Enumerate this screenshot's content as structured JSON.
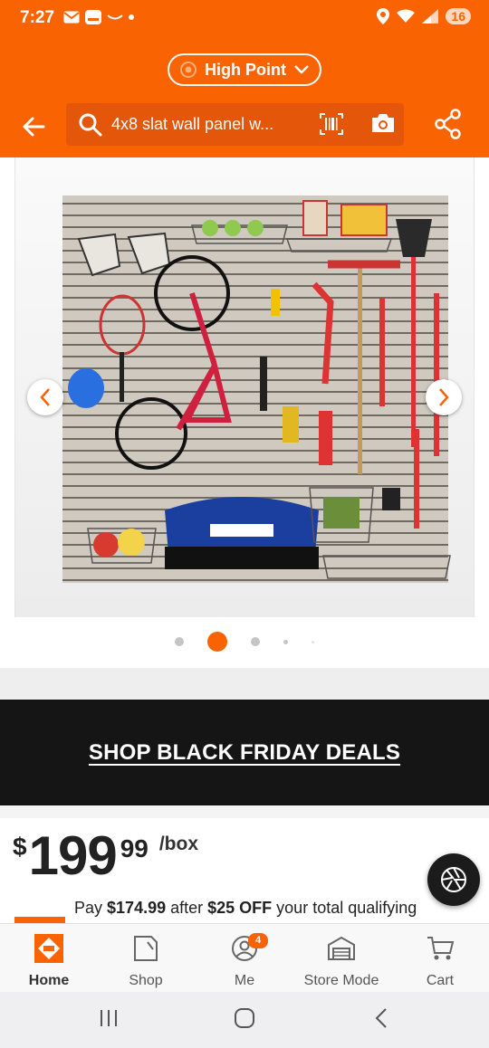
{
  "status_bar": {
    "time": "7:27",
    "battery": "16",
    "left_icons": [
      "gmail-icon",
      "notification-box-icon",
      "amazon-icon",
      "dot-icon"
    ],
    "right_icons": [
      "location-icon",
      "wifi-icon",
      "signal-icon"
    ]
  },
  "header": {
    "store_name": "High Point",
    "search_text": "4x8 slat wall panel w...",
    "icons": [
      "back-arrow-icon",
      "search-icon",
      "barcode-scan-icon",
      "camera-icon",
      "share-icon",
      "store-pin-icon",
      "chevron-down-icon"
    ]
  },
  "gallery": {
    "image_description_icon": "product-image",
    "dots_count": 5,
    "active_index": 1
  },
  "promo_banner": {
    "label": "SHOP BLACK FRIDAY DEALS"
  },
  "price": {
    "currency": "$",
    "whole": "199",
    "cents": "99",
    "unit": "/box"
  },
  "promo": {
    "prefix": "Pay ",
    "amount": "$174.99",
    "middle": " after ",
    "discount": "$25 OFF",
    "suffix": " your total qualifying"
  },
  "bottom_nav": {
    "items": [
      {
        "label": "Home",
        "icon": "home-depot-logo-icon"
      },
      {
        "label": "Shop",
        "icon": "shop-icon"
      },
      {
        "label": "Me",
        "icon": "person-icon",
        "badge": "4"
      },
      {
        "label": "Store Mode",
        "icon": "store-icon"
      },
      {
        "label": "Cart",
        "icon": "cart-icon"
      }
    ]
  },
  "colors": {
    "brand_orange": "#f96302",
    "banner_black": "#151515"
  }
}
